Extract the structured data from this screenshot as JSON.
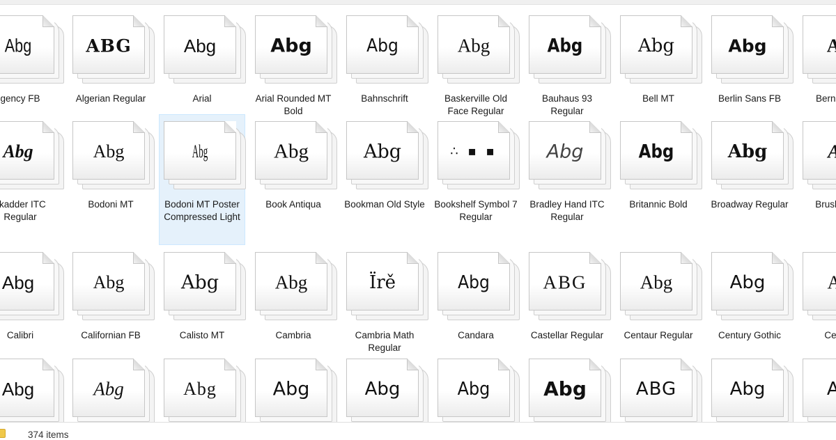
{
  "status": {
    "item_count": "374 items"
  },
  "rows": [
    [
      {
        "label": "Agency FB",
        "display": "gency FB",
        "sample": "Abg"
      },
      {
        "label": "Algerian Regular",
        "sample": "ABG"
      },
      {
        "label": "Arial",
        "sample": "Abg"
      },
      {
        "label": "Arial Rounded MT Bold",
        "sample": "Abg"
      },
      {
        "label": "Bahnschrift",
        "sample": "Abg"
      },
      {
        "label": "Baskerville Old Face Regular",
        "sample": "Abg"
      },
      {
        "label": "Bauhaus 93 Regular",
        "sample": "Abg"
      },
      {
        "label": "Bell MT",
        "sample": "Abg"
      },
      {
        "label": "Berlin Sans FB",
        "sample": "Abg"
      },
      {
        "label": "Bernard MT Condensed",
        "display": "Berna Cond",
        "sample": "Ab"
      }
    ],
    [
      {
        "label": "Blackadder ITC Regular",
        "display": "ckadder ITC Regular",
        "sample": "Abg"
      },
      {
        "label": "Bodoni MT",
        "sample": "Abg"
      },
      {
        "label": "Bodoni MT Poster Compressed Light",
        "sample": "Abg",
        "selected": true
      },
      {
        "label": "Book Antiqua",
        "sample": "Abg"
      },
      {
        "label": "Bookman Old Style",
        "sample": "Abg"
      },
      {
        "label": "Bookshelf Symbol 7 Regular",
        "sample": "∴ ▪ ▪"
      },
      {
        "label": "Bradley Hand ITC Regular",
        "sample": "Abg"
      },
      {
        "label": "Britannic Bold",
        "sample": "Abg"
      },
      {
        "label": "Broadway Regular",
        "sample": "Abg"
      },
      {
        "label": "Brush Script MT Italic",
        "display": "Brush Sc Ita",
        "sample": "Ab"
      }
    ],
    [
      {
        "label": "Calibri",
        "sample": "Abg"
      },
      {
        "label": "Californian FB",
        "sample": "Abg"
      },
      {
        "label": "Calisto MT",
        "sample": "Abg"
      },
      {
        "label": "Cambria",
        "sample": "Abg"
      },
      {
        "label": "Cambria Math Regular",
        "sample": "Ïrě"
      },
      {
        "label": "Candara",
        "sample": "Abg"
      },
      {
        "label": "Castellar Regular",
        "sample": "ABG"
      },
      {
        "label": "Centaur Regular",
        "sample": "Abg"
      },
      {
        "label": "Century Gothic",
        "sample": "Abg"
      },
      {
        "label": "Century",
        "display": "Century",
        "sample": "Ab"
      }
    ],
    [
      {
        "label": "",
        "sample": "Abg"
      },
      {
        "label": "",
        "sample": "Abg"
      },
      {
        "label": "",
        "sample": "Abg"
      },
      {
        "label": "",
        "sample": "Abg"
      },
      {
        "label": "",
        "sample": "Abg"
      },
      {
        "label": "",
        "sample": "Abg"
      },
      {
        "label": "",
        "sample": "Abg"
      },
      {
        "label": "",
        "sample": "ABG"
      },
      {
        "label": "",
        "sample": "Abg"
      },
      {
        "label": "",
        "sample": "Ab"
      }
    ]
  ]
}
